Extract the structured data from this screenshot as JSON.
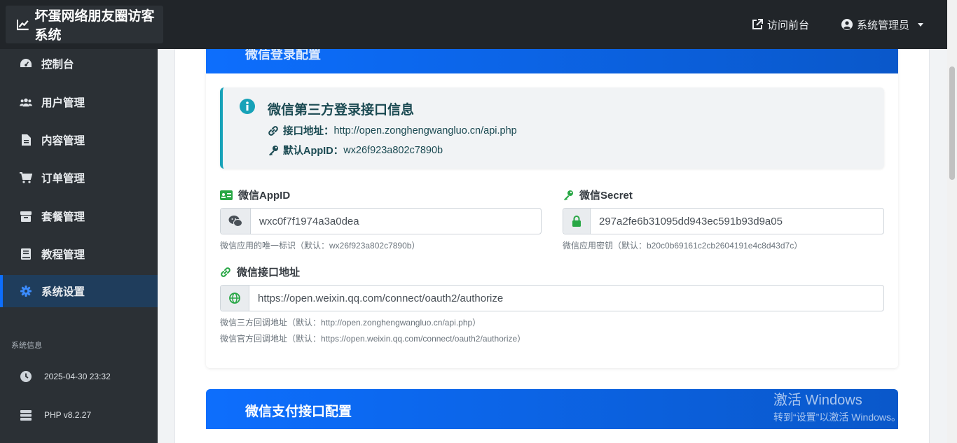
{
  "navbar": {
    "brand": "坏蛋网络朋友圈访客系统",
    "visit_frontend": "访问前台",
    "admin_user": "系统管理员"
  },
  "sidebar": {
    "items": [
      {
        "label": "控制台",
        "icon": "dashboard-icon"
      },
      {
        "label": "用户管理",
        "icon": "users-icon"
      },
      {
        "label": "内容管理",
        "icon": "file-icon"
      },
      {
        "label": "订单管理",
        "icon": "cart-icon"
      },
      {
        "label": "套餐管理",
        "icon": "box-icon"
      },
      {
        "label": "教程管理",
        "icon": "book-icon"
      },
      {
        "label": "系统设置",
        "icon": "gear-icon",
        "active": true
      }
    ],
    "section_title": "系统信息",
    "datetime": "2025-04-30 23:32",
    "php_version": "PHP v8.2.27"
  },
  "wechat_login": {
    "title": "微信登录配置",
    "info_title": "微信第三方登录接口信息",
    "api_label": "接口地址：",
    "api_url": "http://open.zonghengwangluo.cn/api.php",
    "default_appid_label": "默认AppID：",
    "default_appid": "wx26f923a802c7890b",
    "appid_label": "微信AppID",
    "appid_value": "wxc0f7f1974a3a0dea",
    "appid_hint": "微信应用的唯一标识（默认：wx26f923a802c7890b）",
    "secret_label": "微信Secret",
    "secret_value": "297a2fe6b31095dd943ec591b93d9a05",
    "secret_hint": "微信应用密钥（默认：b20c0b69161c2cb2604191e4c8d43d7c）",
    "endpoint_label": "微信接口地址",
    "endpoint_value": "https://open.weixin.qq.com/connect/oauth2/authorize",
    "endpoint_hint1": "微信三方回调地址（默认：http://open.zonghengwangluo.cn/api.php）",
    "endpoint_hint2": "微信官方回调地址（默认：https://open.weixin.qq.com/connect/oauth2/authorize）"
  },
  "wechat_pay": {
    "title": "微信支付接口配置"
  },
  "watermark": {
    "line1": "激活 Windows",
    "line2": "转到“设置”以激活 Windows。"
  },
  "colors": {
    "primary": "#0d6efd",
    "info": "#17a2b8",
    "success": "#28a745",
    "sidebar_bg": "#2b3035",
    "navbar_bg": "#212529"
  }
}
